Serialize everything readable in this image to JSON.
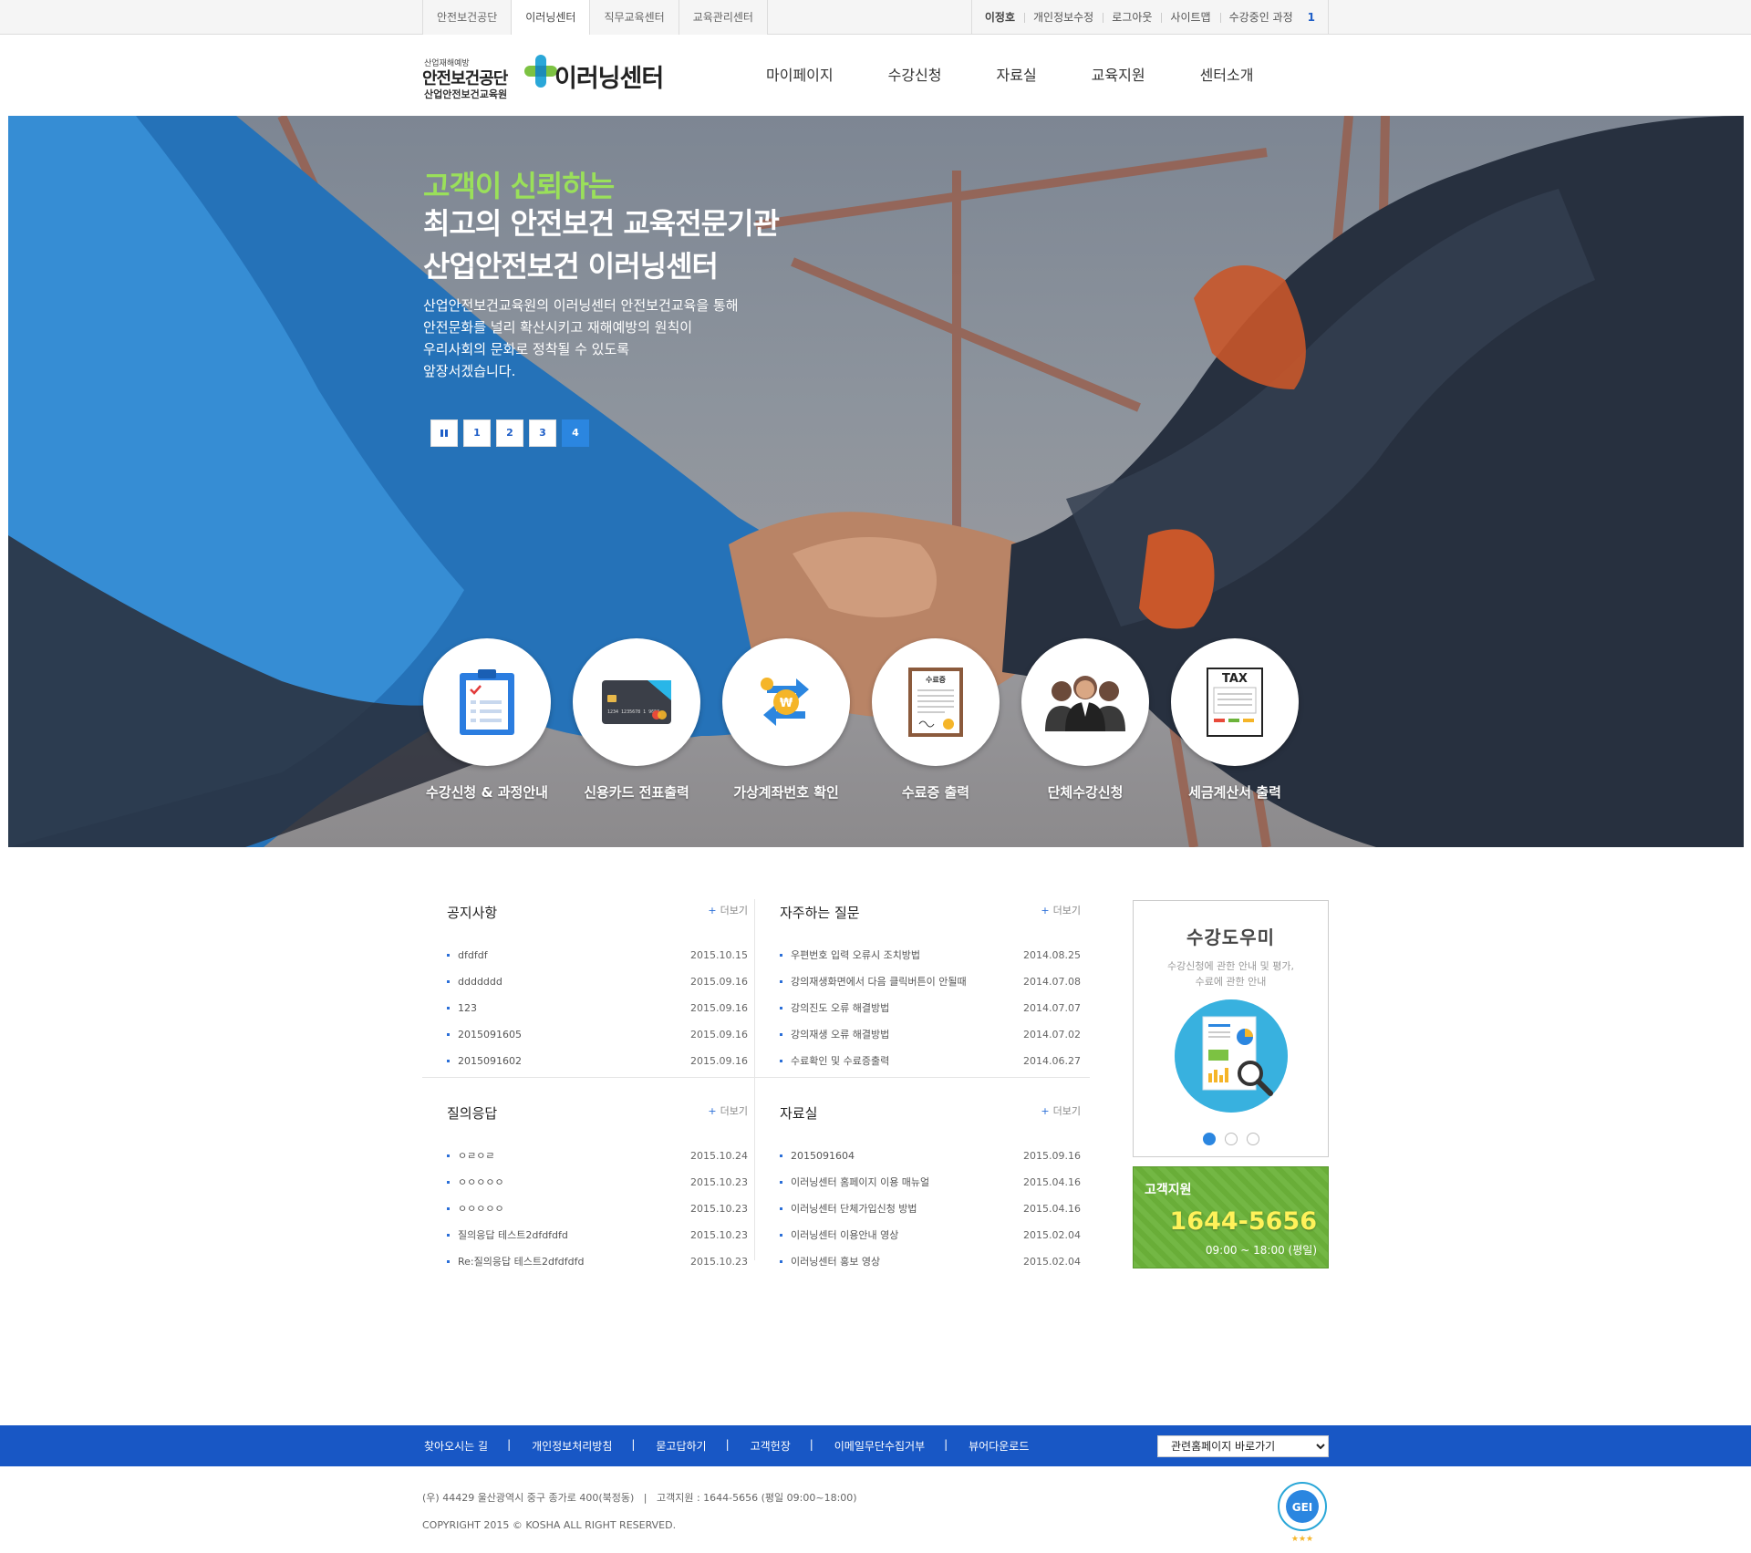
{
  "topbar": {
    "tabs": [
      {
        "label": "안전보건공단"
      },
      {
        "label": "이러닝센터"
      },
      {
        "label": "직무교육센터"
      },
      {
        "label": "교육관리센터"
      }
    ],
    "user_name": "이정호",
    "links": [
      "개인정보수정",
      "로그아웃",
      "사이트맵"
    ],
    "course_label": "수강중인 과정",
    "course_count": "1"
  },
  "header": {
    "logo_small": "산업재해예방",
    "logo_main": "안전보건공단",
    "logo_sub": "산업안전보건교육원",
    "logo_center": "이러닝센터",
    "gnb": [
      "마이페이지",
      "수강신청",
      "자료실",
      "교육지원",
      "센터소개"
    ]
  },
  "hero": {
    "line1": "고객이 신뢰하는",
    "line2": "최고의 안전보건 교육전문기관",
    "line3": "산업안전보건 이러닝센터",
    "desc": [
      "산업안전보건교육원의 이러닝센터 안전보건교육을 통해",
      "안전문화를 널리 확산시키고 재해예방의 원칙이",
      "우리사회의 문화로 정착될 수 있도록",
      "앞장서겠습니다."
    ],
    "pager": [
      "1",
      "2",
      "3",
      "4"
    ],
    "active_slide": "4",
    "quick_menu": [
      {
        "label": "수강신청 & 과정안내",
        "icon": "clipboard-icon"
      },
      {
        "label": "신용카드 전표출력",
        "icon": "credit-card-icon"
      },
      {
        "label": "가상계좌번호 확인",
        "icon": "currency-exchange-icon"
      },
      {
        "label": "수료증 출력",
        "icon": "certificate-icon"
      },
      {
        "label": "단체수강신청",
        "icon": "group-icon"
      },
      {
        "label": "세금계산서 출력",
        "icon": "tax-invoice-icon"
      }
    ],
    "card_number": "1234 1235678 1 9653",
    "certificate_label": "수료증",
    "tax_label": "TAX"
  },
  "boards": {
    "more_label": "더보기",
    "notice": {
      "title": "공지사항",
      "items": [
        {
          "title": "dfdfdf",
          "date": "2015.10.15"
        },
        {
          "title": "ddddddd",
          "date": "2015.09.16"
        },
        {
          "title": "123",
          "date": "2015.09.16"
        },
        {
          "title": "2015091605",
          "date": "2015.09.16"
        },
        {
          "title": "2015091602",
          "date": "2015.09.16"
        }
      ]
    },
    "faq": {
      "title": "자주하는 질문",
      "items": [
        {
          "title": "우편번호 입력 오류시 조치방법",
          "date": "2014.08.25"
        },
        {
          "title": "강의재생화면에서 다음 클릭버튼이 안될때",
          "date": "2014.07.08"
        },
        {
          "title": "강의진도 오류 해결방법",
          "date": "2014.07.07"
        },
        {
          "title": "강의재생 오류 해결방법",
          "date": "2014.07.02"
        },
        {
          "title": "수료확인 및 수료증출력",
          "date": "2014.06.27"
        }
      ]
    },
    "qna": {
      "title": "질의응답",
      "items": [
        {
          "title": "ㅇㄹㅇㄹ",
          "date": "2015.10.24"
        },
        {
          "title": "ㅇㅇㅇㅇㅇ",
          "date": "2015.10.23"
        },
        {
          "title": "ㅇㅇㅇㅇㅇ",
          "date": "2015.10.23"
        },
        {
          "title": "질의응답 테스트2dfdfdfd",
          "date": "2015.10.23"
        },
        {
          "title": "Re:질의응답 테스트2dfdfdfd",
          "date": "2015.10.23"
        }
      ]
    },
    "archive": {
      "title": "자료실",
      "items": [
        {
          "title": "2015091604",
          "date": "2015.09.16"
        },
        {
          "title": "이러닝센터 홈페이지 이용 매뉴얼",
          "date": "2015.04.16"
        },
        {
          "title": "이러닝센터 단체가입신청 방법",
          "date": "2015.04.16"
        },
        {
          "title": "이러닝센터 이용안내 영상",
          "date": "2015.02.04"
        },
        {
          "title": "이러닝센터 홍보 영상",
          "date": "2015.02.04"
        }
      ]
    }
  },
  "helper": {
    "title": "수강도우미",
    "desc1": "수강신청에 관한 안내 및 평가,",
    "desc2": "수료에 관한 안내",
    "active_dot": 1
  },
  "support": {
    "title": "고객지원",
    "phone": "1644-5656",
    "hours": "09:00 ~ 18:00 (평일)"
  },
  "footer": {
    "links": [
      "찾아오시는 길",
      "개인정보처리방침",
      "묻고답하기",
      "고객헌장",
      "이메일무단수집거부",
      "뷰어다운로드"
    ],
    "select_label": "관련홈페이지 바로가기",
    "address": "(우) 44429 울산광역시 중구 종가로 400(북정동)   |   고객지원 : 1644-5656 (평일 09:00~18:00)",
    "copyright": "COPYRIGHT 2015 © KOSHA ALL RIGHT RESERVED.",
    "badge_label": "GEI"
  },
  "colors": {
    "accent": "#1857c5",
    "green": "#6cb33a",
    "hero_green": "#9ae05a"
  }
}
